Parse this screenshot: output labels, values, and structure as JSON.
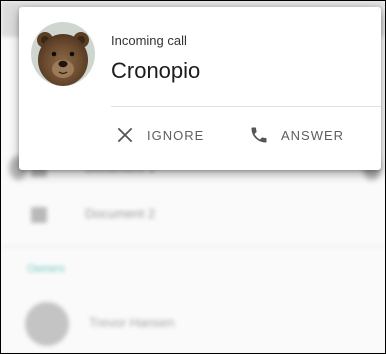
{
  "notification": {
    "subtitle": "Incoming call",
    "caller_name": "Cronopio",
    "avatar_icon": "bear-avatar",
    "actions": {
      "ignore": {
        "label": "IGNORE",
        "icon": "close-icon"
      },
      "answer": {
        "label": "ANSWER",
        "icon": "phone-icon"
      }
    }
  },
  "background_list": {
    "items": [
      {
        "label": "Document 1"
      },
      {
        "label": "Document 2"
      }
    ],
    "section_header": "Owners",
    "owner": {
      "name": "Trevor Hansen"
    }
  },
  "colors": {
    "section_accent": "#6fc9c0",
    "card_background": "#ffffff",
    "action_text": "#5e5e5e"
  }
}
